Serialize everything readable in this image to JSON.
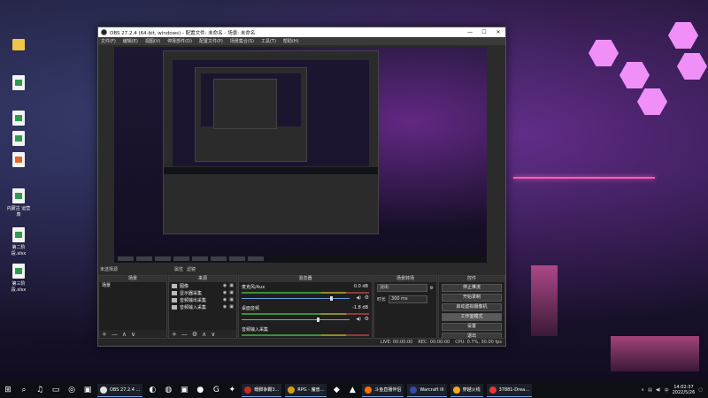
{
  "desktop": {
    "icons": [
      {
        "label": "",
        "type": "folder"
      },
      {
        "label": "",
        "type": "excel"
      },
      {
        "label": "",
        "type": "excel"
      },
      {
        "label": "",
        "type": "excel"
      },
      {
        "label": "",
        "type": "ppt"
      },
      {
        "label": "",
        "type": "excel"
      },
      {
        "label": "内蒙古\n运营表",
        "type": "excel"
      },
      {
        "label": "第二阶段.xlsx",
        "type": "excel"
      },
      {
        "label": "第三阶段.xlsx",
        "type": "excel"
      }
    ]
  },
  "obs": {
    "title": "OBS 27.2.4 (64-bit, windows) - 配置文件: 未命名 - 场景: 未命名",
    "menu": [
      "文件(F)",
      "编辑(E)",
      "视图(V)",
      "停靠部件(D)",
      "配置文件(P)",
      "场景集合(S)",
      "工具(T)",
      "帮助(H)"
    ],
    "window_buttons": [
      "—",
      "☐",
      "✕"
    ],
    "bottom_label": "未选择源",
    "filter_labels": [
      "属性",
      "滤镜"
    ],
    "docks": {
      "scenes": {
        "title": "场景",
        "items": [
          "场景"
        ]
      },
      "sources": {
        "title": "来源",
        "items": [
          {
            "label": "图像"
          },
          {
            "label": "显示器采集"
          },
          {
            "label": "音频输出采集"
          },
          {
            "label": "音频输入采集"
          }
        ]
      },
      "mixer": {
        "title": "混音器",
        "channels": [
          {
            "name": "麦克风/Aux",
            "db": "0.0 dB",
            "level": 0.82
          },
          {
            "name": "桌面音频",
            "db": "-1.8 dB",
            "level": 0.7
          },
          {
            "name": "音频输入采集",
            "db": "",
            "level": 0.6
          }
        ]
      },
      "transitions": {
        "title": "场景转场",
        "type": "淡出",
        "duration_label": "时长",
        "duration": "300 ms"
      },
      "controls": {
        "title": "控件",
        "buttons": [
          "停止推流",
          "开始录制",
          "启动虚拟摄像机",
          "工作室模式",
          "设置",
          "退出"
        ]
      }
    },
    "footer_symbols": [
      "+",
      "—",
      "∧",
      "∨"
    ],
    "status": [
      "LIVE: 00:00:00",
      "REC: 00:00:00",
      "CPU: 0.7%, 30.00 fps"
    ]
  },
  "taskbar": {
    "apps": [
      {
        "label": "OBS 27.2.4 ...",
        "color": "#e2e2e2"
      },
      {
        "label": "暖脚争霸3...",
        "color": "#c62828"
      },
      {
        "label": "RPG - 魔兽...",
        "color": "#d4a017"
      },
      {
        "label": "斗鱼直播伴侣",
        "color": "#ff6f00"
      },
      {
        "label": "Warcraft III",
        "color": "#3949ab"
      },
      {
        "label": "穿越火线",
        "color": "#f9a825"
      },
      {
        "label": "37881-Drea...",
        "color": "#e53935"
      }
    ],
    "clock_time": "14:02:37",
    "clock_date": "2022/5/26",
    "tray_lang": "中"
  }
}
